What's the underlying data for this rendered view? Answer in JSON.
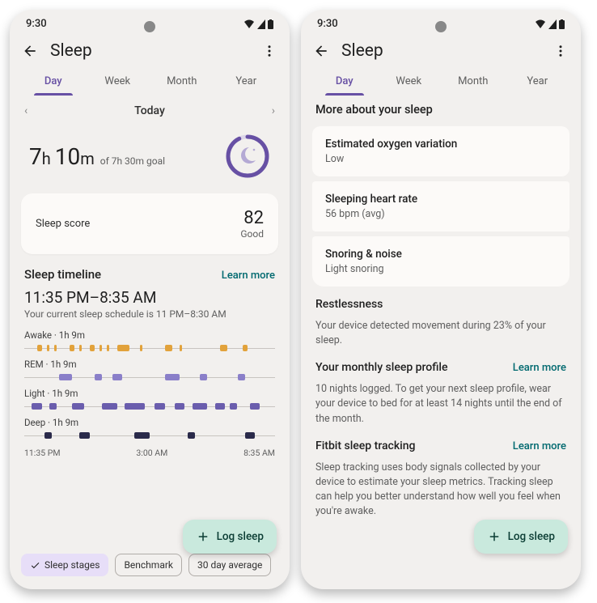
{
  "status": {
    "time": "9:30"
  },
  "appbar": {
    "title": "Sleep"
  },
  "tabs": [
    "Day",
    "Week",
    "Month",
    "Year"
  ],
  "active_tab": 0,
  "date_nav": {
    "label": "Today"
  },
  "duration": {
    "hours": "7",
    "minutes": "10",
    "goal_suffix": "of 7h 30m goal"
  },
  "score": {
    "label": "Sleep score",
    "value": "82",
    "word": "Good"
  },
  "timeline": {
    "title": "Sleep timeline",
    "learn_more": "Learn more",
    "range": "11:35 PM–8:35 AM",
    "schedule_note": "Your current sleep schedule is 11 PM–8:30 AM",
    "stages": [
      {
        "name": "Awake",
        "dur": "1h 9m"
      },
      {
        "name": "REM",
        "dur": "1h 9m"
      },
      {
        "name": "Light",
        "dur": "1h 9m"
      },
      {
        "name": "Deep",
        "dur": "1h 9m"
      }
    ],
    "axis": [
      "11:35 PM",
      "3:00 AM",
      "8:35 AM"
    ]
  },
  "chips": {
    "stages": "Sleep stages",
    "benchmark": "Benchmark",
    "avg": "30 day average"
  },
  "fab": {
    "label": "Log sleep"
  },
  "right": {
    "more_heading": "More about your sleep",
    "cards": [
      {
        "title": "Estimated oxygen variation",
        "sub": "Low"
      },
      {
        "title": "Sleeping heart rate",
        "sub": "56 bpm (avg)"
      },
      {
        "title": "Snoring & noise",
        "sub": "Light snoring"
      }
    ],
    "restlessness": {
      "title": "Restlessness",
      "body": "Your device detected movement during 23% of your sleep."
    },
    "monthly": {
      "title": "Your monthly sleep profile",
      "learn_more": "Learn more",
      "body": "10 nights logged. To get your next sleep profile, wear your device to bed for at least 14 nights until the end of the month."
    },
    "fitbit": {
      "title": "Fitbit sleep tracking",
      "learn_more": "Learn more",
      "body": "Sleep tracking uses body signals collected by your device to estimate your sleep metrics. Tracking sleep can help you better understand how well you feel when you're awake."
    }
  },
  "chart_data": {
    "type": "bar",
    "title": "Sleep timeline",
    "x_range": [
      "11:35 PM",
      "8:35 AM"
    ],
    "series": [
      {
        "name": "Awake",
        "duration": "1h 9m",
        "segments_pct": [
          [
            5,
            2
          ],
          [
            9,
            1
          ],
          [
            12,
            1
          ],
          [
            18,
            2
          ],
          [
            22,
            1
          ],
          [
            26,
            2
          ],
          [
            30,
            1
          ],
          [
            33,
            1
          ],
          [
            37,
            5
          ],
          [
            46,
            1
          ],
          [
            56,
            3
          ],
          [
            62,
            1
          ],
          [
            78,
            3
          ],
          [
            87,
            2
          ]
        ]
      },
      {
        "name": "REM",
        "duration": "1h 9m",
        "segments_pct": [
          [
            14,
            5
          ],
          [
            28,
            3
          ],
          [
            35,
            4
          ],
          [
            56,
            6
          ],
          [
            70,
            3
          ],
          [
            85,
            3
          ]
        ]
      },
      {
        "name": "Light",
        "duration": "1h 9m",
        "segments_pct": [
          [
            3,
            4
          ],
          [
            10,
            3
          ],
          [
            19,
            5
          ],
          [
            31,
            6
          ],
          [
            40,
            8
          ],
          [
            52,
            4
          ],
          [
            60,
            4
          ],
          [
            67,
            6
          ],
          [
            76,
            4
          ],
          [
            82,
            3
          ],
          [
            90,
            4
          ]
        ]
      },
      {
        "name": "Deep",
        "duration": "1h 9m",
        "segments_pct": [
          [
            8,
            3
          ],
          [
            22,
            4
          ],
          [
            44,
            6
          ],
          [
            65,
            3
          ],
          [
            88,
            4
          ]
        ]
      }
    ]
  }
}
